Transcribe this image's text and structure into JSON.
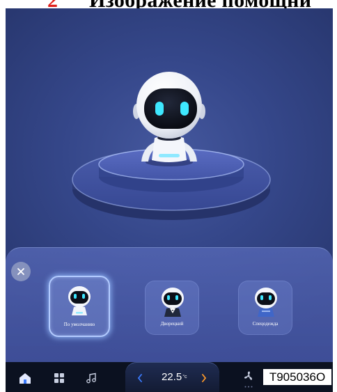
{
  "header": {
    "step_number": "2",
    "title": "Изображение помощни"
  },
  "avatar_picker": {
    "close_icon": "close-icon",
    "options": [
      {
        "label": "По умолчанию",
        "selected": true,
        "icon": "robot-default-icon"
      },
      {
        "label": "Дворецкий",
        "selected": false,
        "icon": "robot-butler-icon"
      },
      {
        "label": "Спецодежда",
        "selected": false,
        "icon": "robot-workwear-icon"
      }
    ]
  },
  "dock": {
    "icons": [
      "home-icon",
      "apps-grid-icon",
      "music-icon",
      "chevron-left-icon",
      "chevron-right-icon",
      "fan-icon"
    ],
    "temperature": "22.5",
    "temperature_unit": "°c"
  },
  "overlay_label": "T905036O",
  "colors": {
    "step_number": "#e0211c",
    "accent_cyan": "#3ee8ff",
    "temp_down": "#3b7bff",
    "temp_up": "#ff9a2a",
    "screen_background": "#33447f",
    "selected_outline": "#b3cbff"
  }
}
